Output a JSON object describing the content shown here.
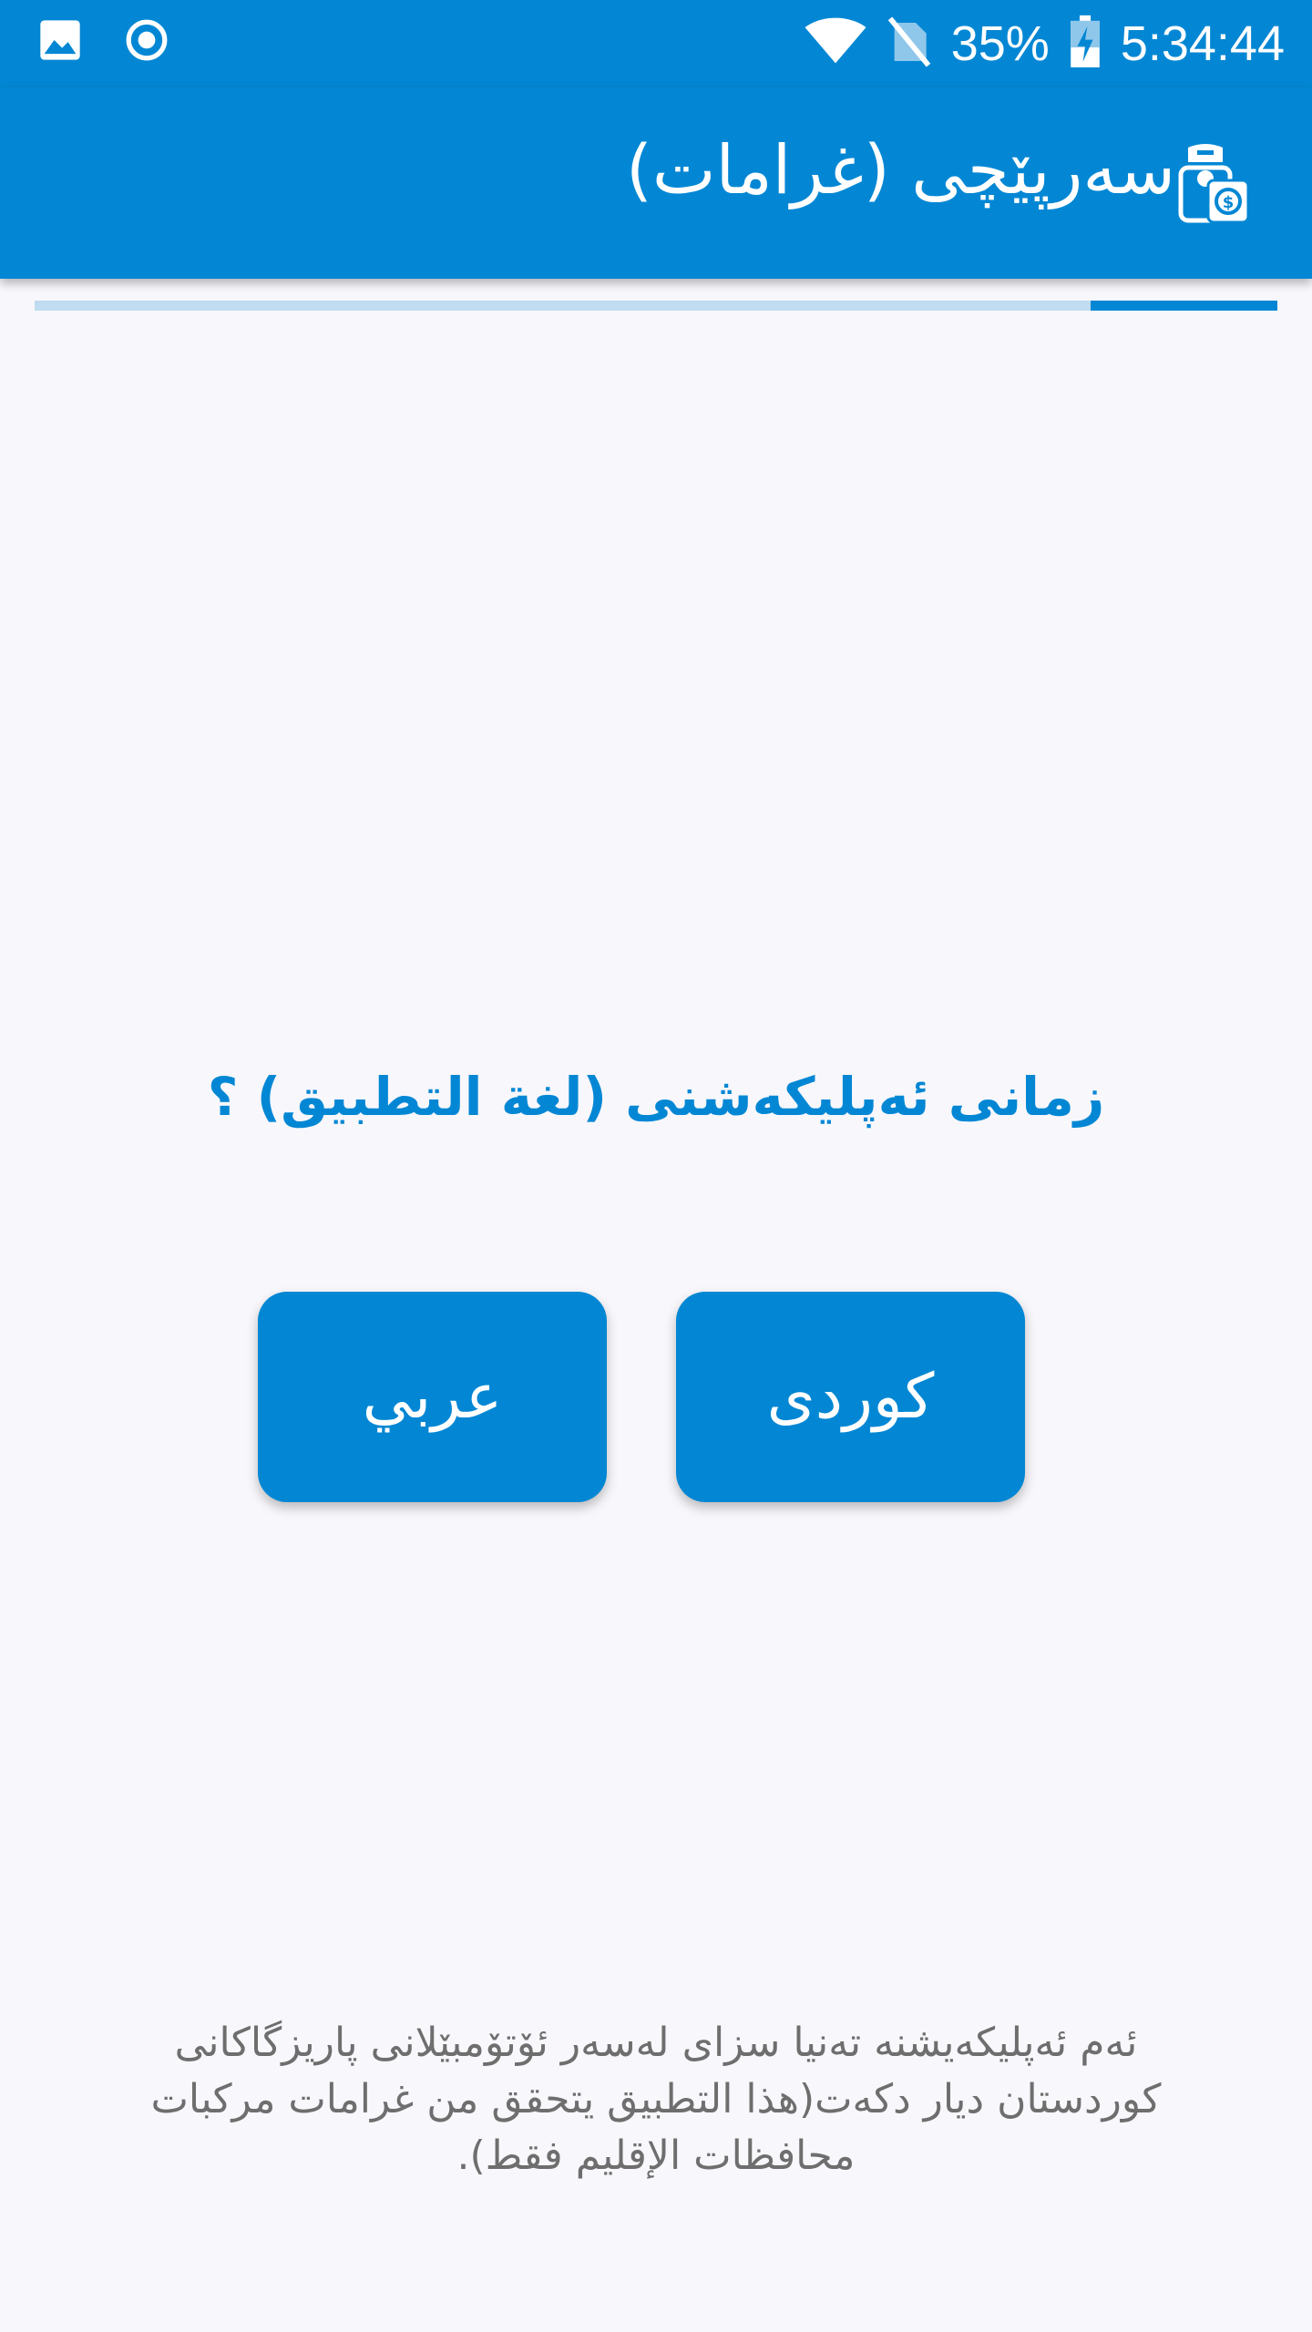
{
  "status_bar": {
    "time": "5:34:44",
    "battery_percent": "35%",
    "left_icons": [
      "image-icon",
      "record-icon"
    ],
    "right_icons": [
      "wifi-icon",
      "no-sim-icon",
      "battery-charging-icon"
    ]
  },
  "app_bar": {
    "title": "سەرپێچی (غرامات)",
    "logo_icon": "traffic-police-fine-icon",
    "background_color": "#0387d4"
  },
  "progress": {
    "fraction": 0.15
  },
  "main": {
    "question": "زمانی ئەپلیکەشنی (لغة التطبيق) ؟",
    "buttons": {
      "kurdish_label": "کوردی",
      "arabic_label": "عربي"
    },
    "footer_note": "ئەم ئەپلیکەیشنە تەنیا سزای لەسەر ئۆتۆمبێلانی پاریزگاکانی کوردستان دیار دکەت(هذا التطبيق يتحقق من غرامات مركبات محافظات الإقليم فقط)."
  },
  "colors": {
    "accent": "#0387d4",
    "background": "#f8f7fb",
    "progress_track": "#bfdcf0",
    "footer_text": "#6e6e6e"
  }
}
